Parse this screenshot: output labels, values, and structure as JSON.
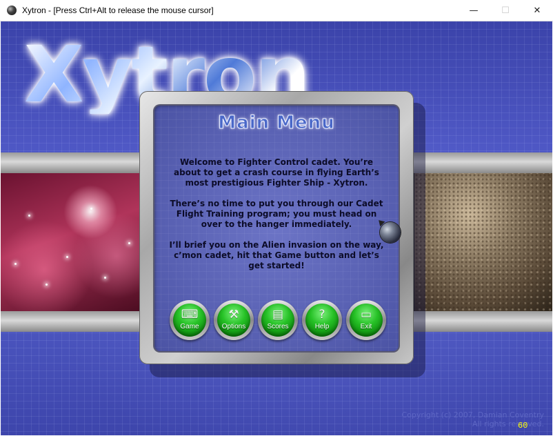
{
  "window": {
    "title": "Xytron - [Press Ctrl+Alt to release the mouse cursor]",
    "minimize": "—",
    "maximize": "☐",
    "close": "✕"
  },
  "logo": {
    "text": "Xytron"
  },
  "menu": {
    "title": "Main Menu",
    "paragraphs": [
      "Welcome to Fighter Control cadet. You’re about to get a crash course in flying Earth’s most prestigious Fighter Ship - Xytron.",
      "There’s no time to put you through our Cadet Flight Training program; you must head on over to the hanger immediately.",
      "I’ll brief you on the Alien invasion on the way, c’mon cadet, hit that Game button and let’s get started!"
    ],
    "buttons": [
      {
        "label": "Game",
        "icon": "keyboard-icon",
        "glyph": "⌨"
      },
      {
        "label": "Options",
        "icon": "tools-icon",
        "glyph": "⚒"
      },
      {
        "label": "Scores",
        "icon": "scores-icon",
        "glyph": "▤"
      },
      {
        "label": "Help",
        "icon": "help-icon",
        "glyph": "?"
      },
      {
        "label": "Exit",
        "icon": "exit-icon",
        "glyph": "▭"
      }
    ]
  },
  "copyright": {
    "line1": "Copyright (c) 2007, Damian Coventry",
    "line2": "All rights reserved."
  },
  "fps": "60",
  "colors": {
    "background": "#4a52b8",
    "panel": "#5961b3",
    "button": "#27c227",
    "fps": "#ffff00"
  }
}
